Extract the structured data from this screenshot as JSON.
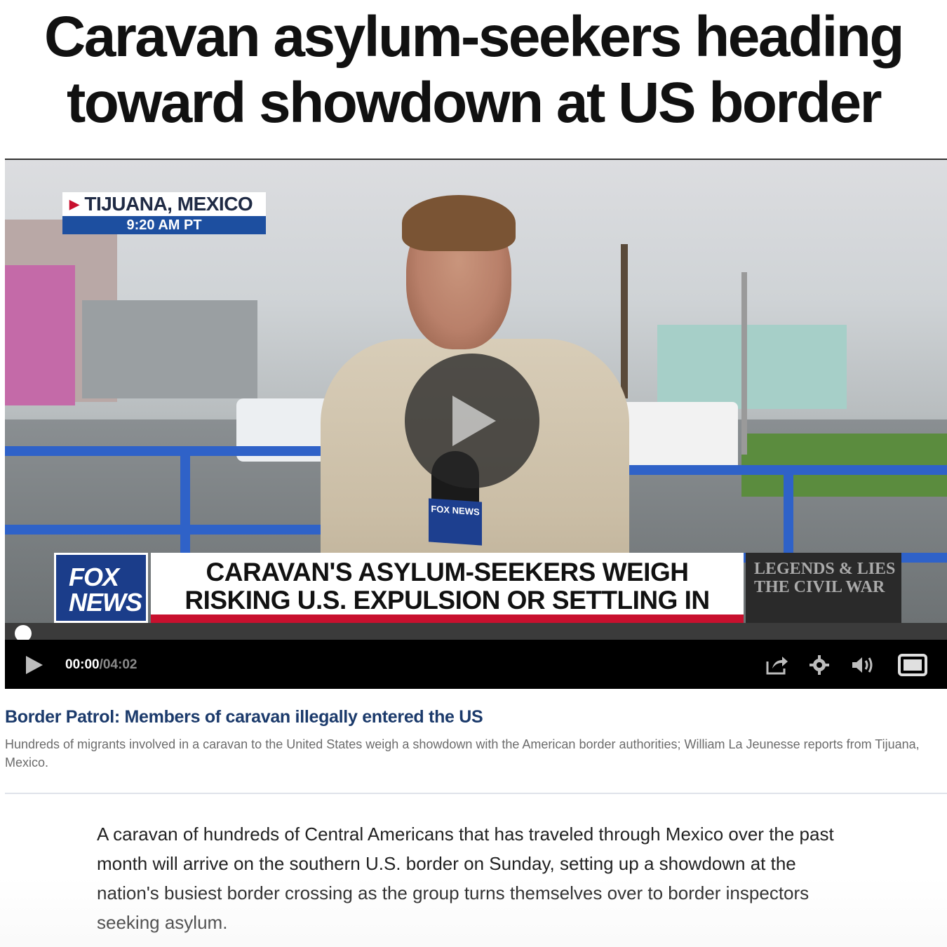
{
  "article": {
    "headline": "Caravan asylum-seekers heading toward showdown at US border"
  },
  "video": {
    "location": "TIJUANA, MEXICO",
    "time_stamp": "9:20 AM PT",
    "network_logo": "FOX NEWS",
    "mic_flag": "FOX NEWS",
    "banner_headline": "CARAVAN'S ASYLUM-SEEKERS WEIGH RISKING U.S. EXPULSION OR SETTLING IN MEXICO",
    "promo": "LEGENDS & LIES THE CIVIL WAR",
    "progress": 0.0
  },
  "controls": {
    "current_time": "00:00",
    "separator": " / ",
    "duration": "04:02",
    "icons": [
      "play-icon",
      "share-icon",
      "gear-icon",
      "volume-icon",
      "fullscreen-icon"
    ]
  },
  "caption": {
    "title": "Border Patrol: Members of caravan illegally entered the US",
    "description": "Hundreds of migrants involved in a caravan to the United States weigh a showdown with the American border authorities; William La Jeunesse reports from Tijuana, Mexico."
  },
  "body": {
    "paragraph": "A caravan of hundreds of Central Americans that has traveled through Mexico over the past month will arrive on the southern U.S. border on Sunday, setting up a showdown at the nation's busiest border crossing as the group turns themselves over to border inspectors seeking asylum."
  },
  "colors": {
    "caption_title": "#1b3a6b",
    "fox_blue": "#1b3d8a",
    "alert_red": "#c8102e"
  }
}
